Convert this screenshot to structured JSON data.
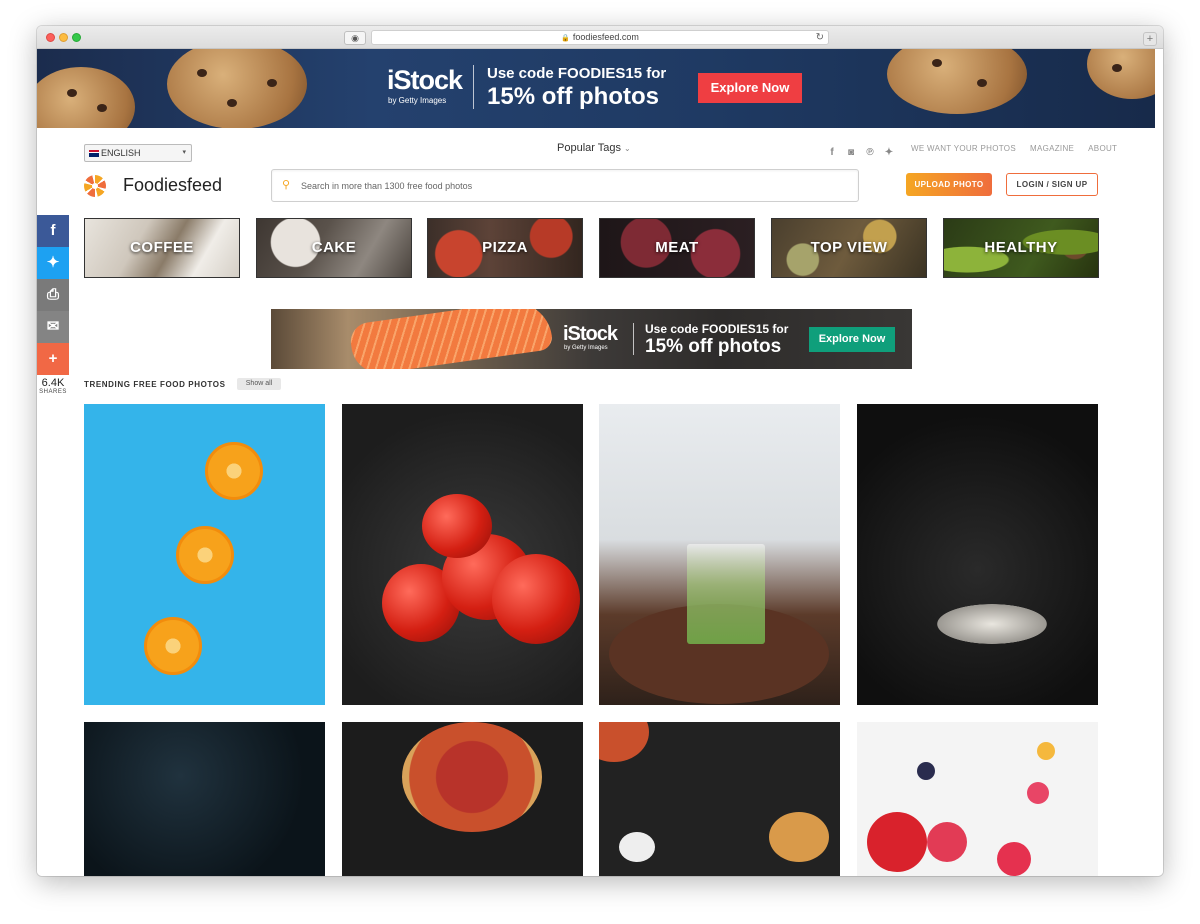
{
  "browser": {
    "url": "foodiesfeed.com"
  },
  "top_ad": {
    "logo": "iStock",
    "logo_sub": "by Getty Images",
    "line1": "Use code FOODIES15 for",
    "line2": "15% off photos",
    "button": "Explore Now"
  },
  "header": {
    "language": "ENGLISH",
    "popular_tags": "Popular Tags",
    "links": [
      "WE WANT YOUR PHOTOS",
      "MAGAZINE",
      "ABOUT"
    ],
    "brand": "Foodiesfeed",
    "search_placeholder": "Search in more than 1300 free food photos",
    "upload": "UPLOAD PHOTO",
    "login": "LOGIN / SIGN UP"
  },
  "share": {
    "count": "6.4K",
    "label": "SHARES"
  },
  "categories": [
    "COFFEE",
    "CAKE",
    "PIZZA",
    "MEAT",
    "TOP VIEW",
    "HEALTHY"
  ],
  "ad2": {
    "logo": "iStock",
    "logo_sub": "by Getty Images",
    "line1": "Use code FOODIES15 for",
    "line2": "15% off photos",
    "button": "Explore Now"
  },
  "trending": {
    "title": "TRENDING FREE FOOD PHOTOS",
    "show_all": "Show all"
  },
  "colors": {
    "accent": "#f5a623",
    "accent2": "#ef6d3c",
    "ad_button": "#ef3e42",
    "ad2_button": "#0f9f7b"
  }
}
